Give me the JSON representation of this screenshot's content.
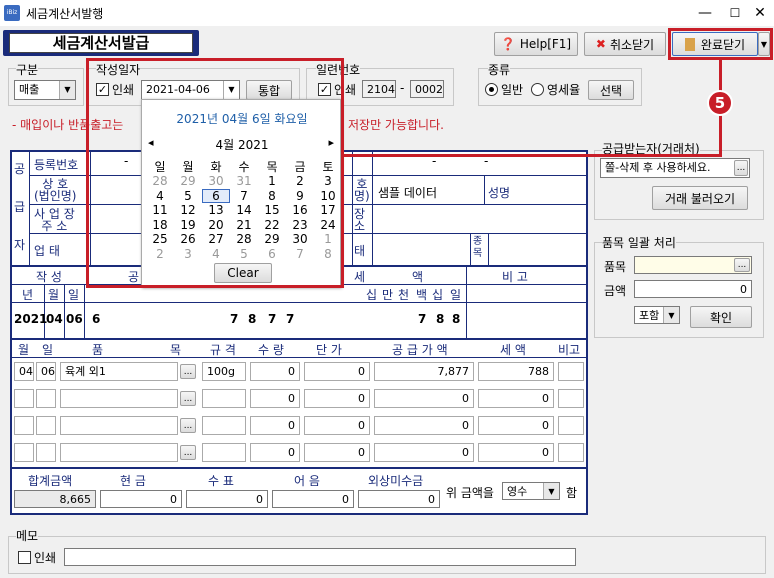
{
  "window": {
    "title": "세금계산서발행",
    "min": "—",
    "max": "☐",
    "close": "✕"
  },
  "header": {
    "title": "세금계산서발급",
    "help": "Help[F1]",
    "cancel": "취소닫기",
    "done": "완료닫기"
  },
  "top": {
    "gubun_label": "구분",
    "gubun_value": "매출",
    "date_label": "작성일자",
    "print_label": "인쇄",
    "date_value": "2021-04-06",
    "merge_btn": "통합",
    "serial_label": "일련번호",
    "serial_print": "인쇄",
    "serial1": "2104",
    "serial_dash": "-",
    "serial2": "0002",
    "kind_label": "종류",
    "kind_general": "일반",
    "kind_zero": "영세율",
    "select_btn": "선택"
  },
  "notice": {
    "left": "- 매입이나 반품출고는",
    "right": "저장만 가능합니다."
  },
  "calendar": {
    "header": "2021년 04월 6일 화요일",
    "month": "4월 2021",
    "prev": "◂",
    "next": "▸",
    "weekdays": [
      "일",
      "월",
      "화",
      "수",
      "목",
      "금",
      "토"
    ],
    "weeks": [
      [
        "28",
        "29",
        "30",
        "31",
        "1",
        "2",
        "3"
      ],
      [
        "4",
        "5",
        "6",
        "7",
        "8",
        "9",
        "10"
      ],
      [
        "11",
        "12",
        "13",
        "14",
        "15",
        "16",
        "17"
      ],
      [
        "18",
        "19",
        "20",
        "21",
        "22",
        "23",
        "24"
      ],
      [
        "25",
        "26",
        "27",
        "28",
        "29",
        "30",
        "1"
      ],
      [
        "2",
        "3",
        "4",
        "5",
        "6",
        "7",
        "8"
      ]
    ],
    "clear": "Clear"
  },
  "form": {
    "gong": "공",
    "geup": "급",
    "ja": "자",
    "reg": "등록번호",
    "sanghyo": "상 호\n(법인명)",
    "addr": "사 업 장\n주 소",
    "eop": "업 태",
    "dash": "-",
    "buyer_name_label": "호\n명)",
    "buyer_name": "샘플 데이터",
    "ceo": "성명",
    "jang": "장\n소",
    "tae": "태",
    "jong": "종\n목",
    "jakseong": "작 성",
    "gong2": "공",
    "se": "세",
    "aek": "액",
    "bigo": "비 고",
    "year": "년",
    "month": "월",
    "day": "일",
    "cols_right": [
      "십",
      "만",
      "천",
      "백",
      "십",
      "일"
    ],
    "val_year": "2021",
    "val_month": "04",
    "val_day": "06",
    "val_blank": "6",
    "digits_supply": [
      "7",
      "8",
      "7",
      "7"
    ],
    "digits_tax": [
      "7",
      "8",
      "8"
    ]
  },
  "items": {
    "headers": [
      "월",
      "일",
      "품",
      "목",
      "규 격",
      "수 량",
      "단 가",
      "공 급 가 액",
      "세 액",
      "비고"
    ],
    "rows": [
      {
        "m": "04",
        "d": "06",
        "name": "육계 외1",
        "spec": "100g",
        "qty": "0",
        "price": "0",
        "supply": "7,877",
        "tax": "788"
      },
      {
        "m": "",
        "d": "",
        "name": "",
        "spec": "",
        "qty": "0",
        "price": "0",
        "supply": "0",
        "tax": "0"
      },
      {
        "m": "",
        "d": "",
        "name": "",
        "spec": "",
        "qty": "0",
        "price": "0",
        "supply": "0",
        "tax": "0"
      },
      {
        "m": "",
        "d": "",
        "name": "",
        "spec": "",
        "qty": "0",
        "price": "0",
        "supply": "0",
        "tax": "0"
      }
    ],
    "dots": "..."
  },
  "totals": {
    "total_label": "합계금액",
    "cash": "현 금",
    "check": "수 표",
    "bill": "어 음",
    "credit": "외상미수금",
    "total": "8,665",
    "cash_v": "0",
    "check_v": "0",
    "bill_v": "0",
    "credit_v": "0",
    "wi": "위 금액을",
    "receipt": "영수",
    "ham": "함"
  },
  "right": {
    "receiver_label": "공급받는자(거래처)",
    "receiver_value": "쫄-삭제 후 사용하세요.",
    "load_btn": "거래 불러오기",
    "bulk_label": "품목 일괄 처리",
    "item_label": "품목",
    "amount_label": "금액",
    "amount_value": "0",
    "incl": "포함",
    "confirm": "확인"
  },
  "memo": {
    "label": "메모",
    "print": "인쇄"
  },
  "annotation": {
    "badge": "5"
  }
}
